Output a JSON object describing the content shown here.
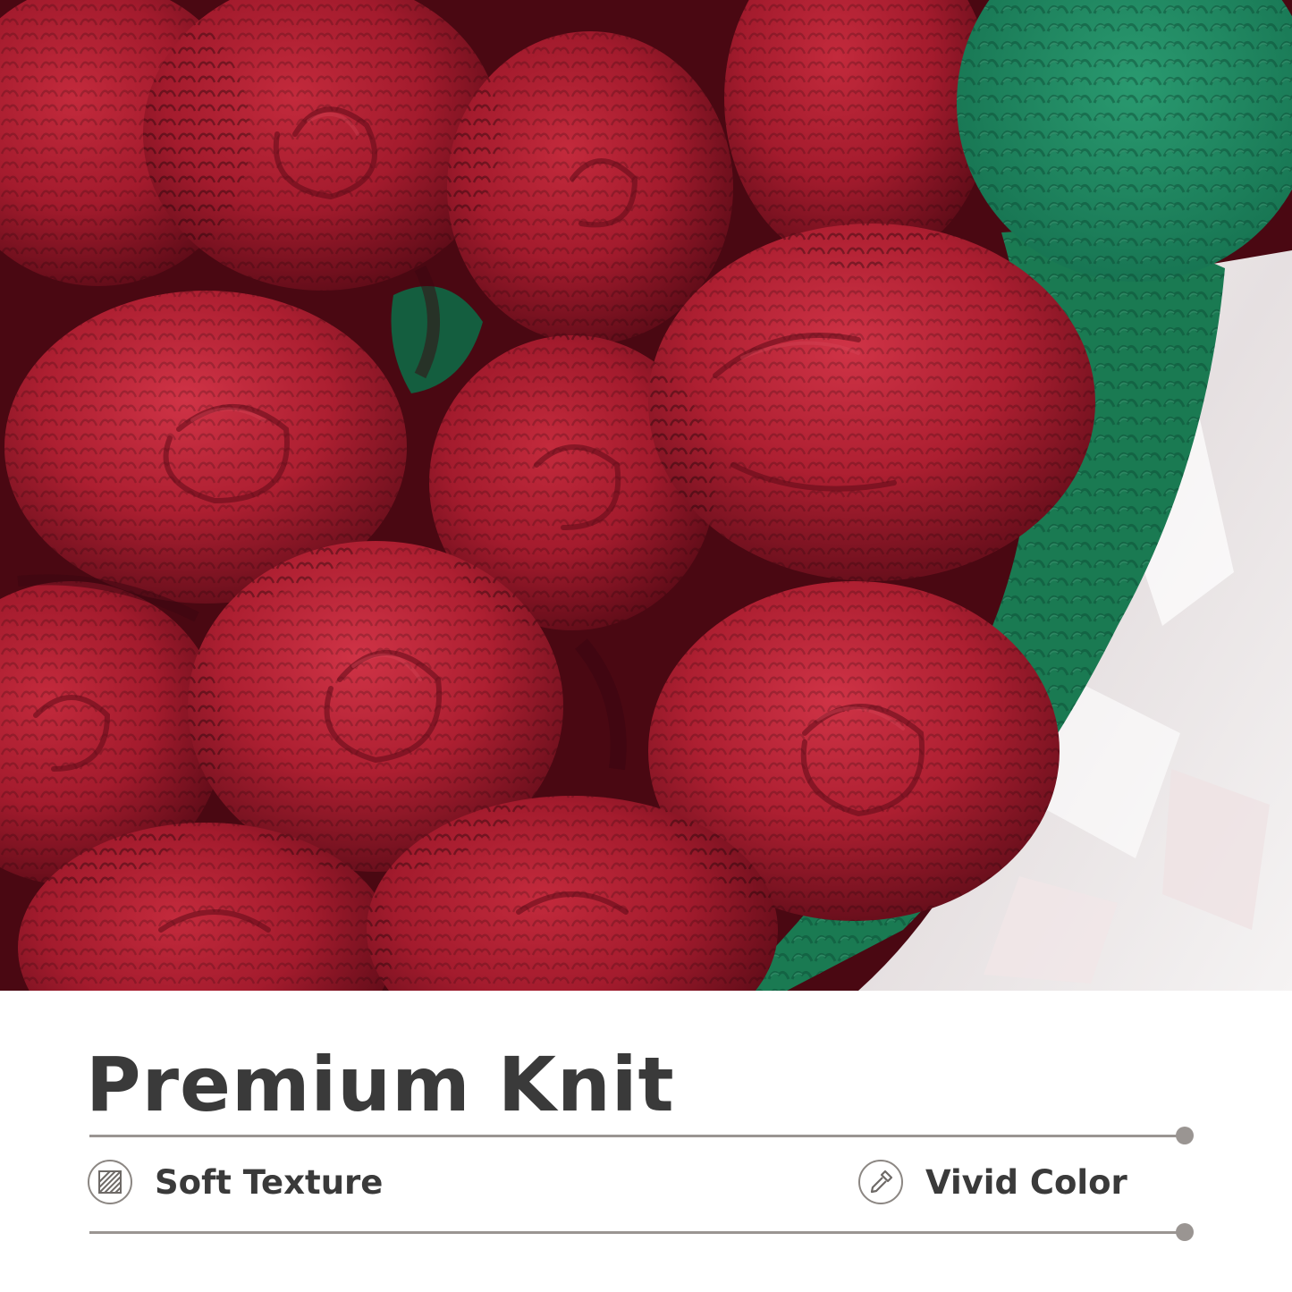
{
  "hero": {
    "subject": "crocheted red rose bouquet in green knit wrap",
    "colors": {
      "rose": "#a11a2c",
      "rose_dark": "#6e0f1c",
      "rose_light": "#c42a3d",
      "wrap_green": "#1a7a52",
      "swatch_green": "#1f8a62",
      "paper_white": "#eeeaea"
    }
  },
  "caption": {
    "title": "Premium Knit",
    "features": [
      {
        "label": "Soft Texture",
        "icon": "striped-swatch-icon"
      },
      {
        "label": "Vivid Color",
        "icon": "eyedropper-icon"
      }
    ],
    "colors": {
      "text": "#3a3a3a",
      "rule": "#9a9592"
    }
  }
}
